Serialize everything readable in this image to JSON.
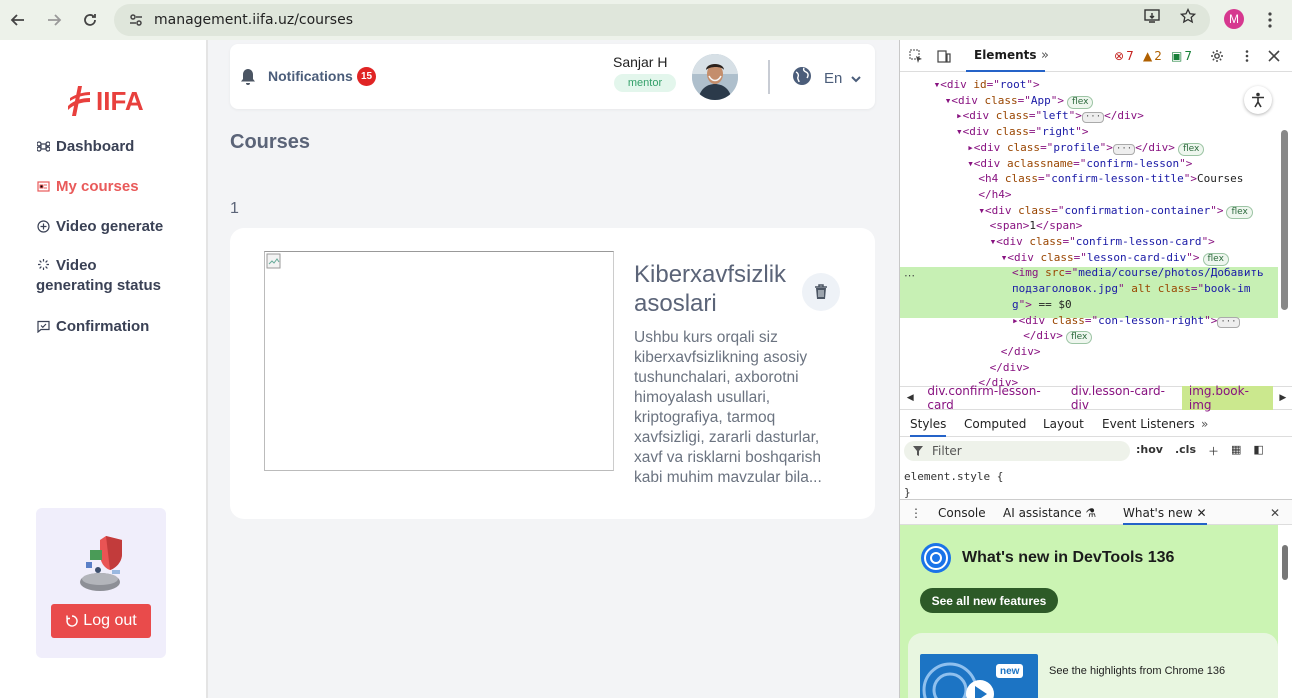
{
  "browser": {
    "url": "management.iifa.uz/courses",
    "profile_initial": "M"
  },
  "sidebar": {
    "logo_text": "IIFA",
    "items": [
      {
        "label": "Dashboard",
        "active": false
      },
      {
        "label": "My courses",
        "active": true
      },
      {
        "label": "Video generate",
        "active": false
      },
      {
        "label": "Video",
        "active": false
      },
      {
        "label": "generating status",
        "active": false
      },
      {
        "label": "Confirmation",
        "active": false
      }
    ],
    "logout_label": "Log out"
  },
  "topbar": {
    "notifications_label": "Notifications",
    "notifications_count": "15",
    "user_name": "Sanjar H",
    "user_role": "mentor",
    "language": "En"
  },
  "main": {
    "page_title": "Courses",
    "count": "1",
    "course": {
      "title": "Kiberxavfsizlik asoslari",
      "description": "Ushbu kurs orqali siz kiberxavfsizlikning asosiy tushunchalari, axborotni himoyalash usullari, kriptografiya, tarmoq xavfsizligi, zararli dasturlar, xavf va risklarni boshqarish kabi muhim mavzular bila..."
    }
  },
  "devtools": {
    "tab_elements": "Elements",
    "errors": "7",
    "warnings": "2",
    "messages": "7",
    "dom_lines": [
      {
        "indent": 3,
        "arrow": "",
        "parts": [
          [
            "tag",
            "▾<div "
          ],
          [
            "attr",
            "id"
          ],
          [
            "tag",
            "=\""
          ],
          [
            "val",
            "root"
          ],
          [
            "tag",
            "\">"
          ]
        ],
        "pill": ""
      },
      {
        "indent": 4,
        "arrow": "",
        "parts": [
          [
            "tag",
            "▾<div "
          ],
          [
            "attr",
            "class"
          ],
          [
            "tag",
            "=\""
          ],
          [
            "val",
            "App"
          ],
          [
            "tag",
            "\">"
          ]
        ],
        "pill": "flex"
      },
      {
        "indent": 5,
        "arrow": "",
        "parts": [
          [
            "tag",
            "▸<div "
          ],
          [
            "attr",
            "class"
          ],
          [
            "tag",
            "=\""
          ],
          [
            "val",
            "left"
          ],
          [
            "tag",
            "\">"
          ],
          [
            "dots",
            ""
          ],
          [
            "tag",
            "</div>"
          ]
        ],
        "pill": ""
      },
      {
        "indent": 5,
        "arrow": "",
        "parts": [
          [
            "tag",
            "▾<div "
          ],
          [
            "attr",
            "class"
          ],
          [
            "tag",
            "=\""
          ],
          [
            "val",
            "right"
          ],
          [
            "tag",
            "\">"
          ]
        ],
        "pill": ""
      },
      {
        "indent": 6,
        "arrow": "",
        "parts": [
          [
            "tag",
            "▸<div "
          ],
          [
            "attr",
            "class"
          ],
          [
            "tag",
            "=\""
          ],
          [
            "val",
            "profile"
          ],
          [
            "tag",
            "\">"
          ],
          [
            "dots",
            ""
          ],
          [
            "tag",
            "</div>"
          ]
        ],
        "pill": "flex"
      },
      {
        "indent": 6,
        "arrow": "",
        "parts": [
          [
            "tag",
            "▾<div "
          ],
          [
            "attr",
            "aclassname"
          ],
          [
            "tag",
            "=\""
          ],
          [
            "val",
            "confirm-lesson"
          ],
          [
            "tag",
            "\">"
          ]
        ],
        "pill": ""
      },
      {
        "indent": 7,
        "arrow": "",
        "parts": [
          [
            "tag",
            "<h4 "
          ],
          [
            "attr",
            "class"
          ],
          [
            "tag",
            "=\""
          ],
          [
            "val",
            "confirm-lesson-title"
          ],
          [
            "tag",
            "\">"
          ],
          [
            "txt",
            "Courses"
          ]
        ],
        "pill": ""
      },
      {
        "indent": 7,
        "arrow": "",
        "parts": [
          [
            "tag",
            "</h4>"
          ]
        ],
        "pill": ""
      },
      {
        "indent": 7,
        "arrow": "",
        "parts": [
          [
            "tag",
            "▾<div "
          ],
          [
            "attr",
            "class"
          ],
          [
            "tag",
            "=\""
          ],
          [
            "val",
            "confirmation-container"
          ],
          [
            "tag",
            "\">"
          ]
        ],
        "pill": "flex"
      },
      {
        "indent": 8,
        "arrow": "",
        "parts": [
          [
            "tag",
            "<span>"
          ],
          [
            "txt",
            "1"
          ],
          [
            "tag",
            "</span>"
          ]
        ],
        "pill": ""
      },
      {
        "indent": 8,
        "arrow": "",
        "parts": [
          [
            "tag",
            "▾<div "
          ],
          [
            "attr",
            "class"
          ],
          [
            "tag",
            "=\""
          ],
          [
            "val",
            "confirm-lesson-card"
          ],
          [
            "tag",
            "\">"
          ]
        ],
        "pill": ""
      },
      {
        "indent": 9,
        "arrow": "",
        "parts": [
          [
            "tag",
            "▾<div "
          ],
          [
            "attr",
            "class"
          ],
          [
            "tag",
            "=\""
          ],
          [
            "val",
            "lesson-card-div"
          ],
          [
            "tag",
            "\">"
          ]
        ],
        "pill": "flex"
      },
      {
        "indent": 10,
        "arrow": "",
        "parts": [
          [
            "tag",
            "<img "
          ],
          [
            "attr",
            "src"
          ],
          [
            "tag",
            "=\""
          ],
          [
            "val",
            "media/course/photos/Добавить"
          ]
        ],
        "pill": ""
      },
      {
        "indent": 10,
        "arrow": "",
        "parts": [
          [
            "val",
            "подзаголовок.jpg"
          ],
          [
            "tag",
            "\" "
          ],
          [
            "attr",
            "alt class"
          ],
          [
            "tag",
            "=\""
          ],
          [
            "val",
            "book-im"
          ]
        ],
        "pill": ""
      },
      {
        "indent": 10,
        "arrow": "",
        "parts": [
          [
            "val",
            "g"
          ],
          [
            "tag",
            "\">"
          ],
          [
            "txt",
            " == $0"
          ]
        ],
        "pill": ""
      },
      {
        "indent": 10,
        "arrow": "",
        "parts": [
          [
            "tag",
            "▸<div "
          ],
          [
            "attr",
            "class"
          ],
          [
            "tag",
            "=\""
          ],
          [
            "val",
            "con-lesson-right"
          ],
          [
            "tag",
            "\">"
          ],
          [
            "dots",
            ""
          ]
        ],
        "pill": ""
      },
      {
        "indent": 11,
        "arrow": "",
        "parts": [
          [
            "tag",
            "</div>"
          ]
        ],
        "pill": "flex"
      },
      {
        "indent": 9,
        "arrow": "",
        "parts": [
          [
            "tag",
            "</div>"
          ]
        ],
        "pill": ""
      },
      {
        "indent": 8,
        "arrow": "",
        "parts": [
          [
            "tag",
            "</div>"
          ]
        ],
        "pill": ""
      },
      {
        "indent": 7,
        "arrow": "",
        "parts": [
          [
            "tag",
            "</div>"
          ]
        ],
        "pill": ""
      }
    ],
    "breadcrumbs": [
      "div.confirm-lesson-card",
      "div.lesson-card-div",
      "img.book-img"
    ],
    "styles_tabs": [
      "Styles",
      "Computed",
      "Layout",
      "Event Listeners"
    ],
    "filter_placeholder": "Filter",
    "hov": ":hov",
    "cls": ".cls",
    "element_style_1": "element.style {",
    "element_style_2": "}",
    "drawer_tabs": [
      "Console",
      "AI assistance",
      "What's new"
    ],
    "whatsnew_title": "What's new in DevTools 136",
    "whatsnew_button": "See all new features",
    "new_badge": "new",
    "highlights": "See the highlights from Chrome 136"
  }
}
